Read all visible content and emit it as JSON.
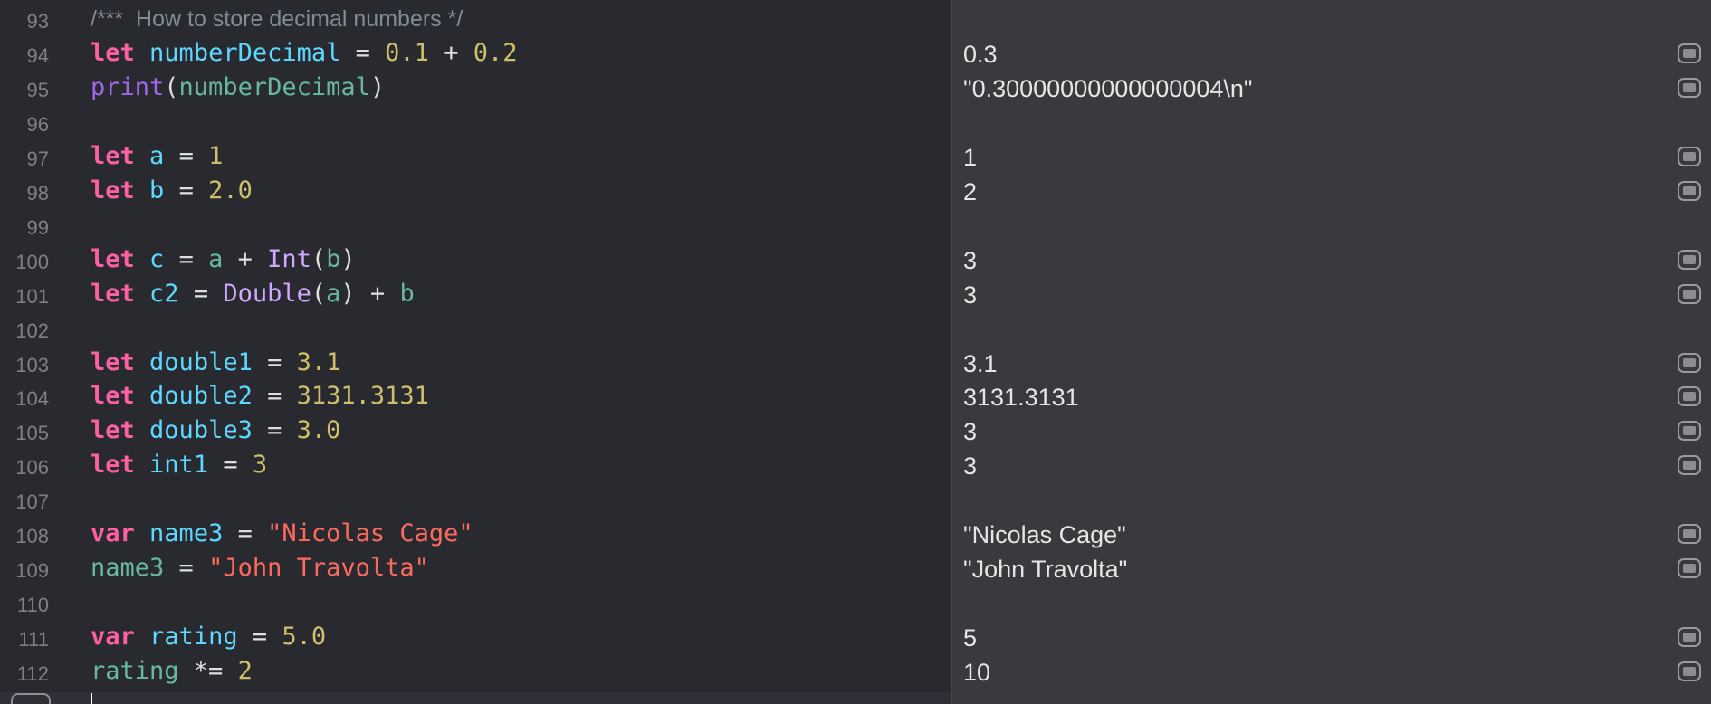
{
  "editor": {
    "lines": [
      {
        "num": "93",
        "comment": true,
        "tokens": [
          {
            "t": "/*** ",
            "c": "comment"
          },
          {
            "t": " How to store decimal numbers */",
            "c": "comment"
          }
        ]
      },
      {
        "num": "94",
        "tokens": [
          {
            "t": "let",
            "c": "kw"
          },
          {
            "t": " ",
            "c": "plain"
          },
          {
            "t": "numberDecimal",
            "c": "var"
          },
          {
            "t": " = ",
            "c": "plain"
          },
          {
            "t": "0.1",
            "c": "num"
          },
          {
            "t": " + ",
            "c": "plain"
          },
          {
            "t": "0.2",
            "c": "num"
          }
        ]
      },
      {
        "num": "95",
        "tokens": [
          {
            "t": "print",
            "c": "fn"
          },
          {
            "t": "(",
            "c": "plain"
          },
          {
            "t": "numberDecimal",
            "c": "ref"
          },
          {
            "t": ")",
            "c": "plain"
          }
        ]
      },
      {
        "num": "96",
        "tokens": []
      },
      {
        "num": "97",
        "tokens": [
          {
            "t": "let",
            "c": "kw"
          },
          {
            "t": " ",
            "c": "plain"
          },
          {
            "t": "a",
            "c": "var"
          },
          {
            "t": " = ",
            "c": "plain"
          },
          {
            "t": "1",
            "c": "num"
          }
        ]
      },
      {
        "num": "98",
        "tokens": [
          {
            "t": "let",
            "c": "kw"
          },
          {
            "t": " ",
            "c": "plain"
          },
          {
            "t": "b",
            "c": "var"
          },
          {
            "t": " = ",
            "c": "plain"
          },
          {
            "t": "2.0",
            "c": "num"
          }
        ]
      },
      {
        "num": "99",
        "tokens": []
      },
      {
        "num": "100",
        "tokens": [
          {
            "t": "let",
            "c": "kw"
          },
          {
            "t": " ",
            "c": "plain"
          },
          {
            "t": "c",
            "c": "var"
          },
          {
            "t": " = ",
            "c": "plain"
          },
          {
            "t": "a",
            "c": "ref"
          },
          {
            "t": " + ",
            "c": "plain"
          },
          {
            "t": "Int",
            "c": "type"
          },
          {
            "t": "(",
            "c": "plain"
          },
          {
            "t": "b",
            "c": "ref"
          },
          {
            "t": ")",
            "c": "plain"
          }
        ]
      },
      {
        "num": "101",
        "tokens": [
          {
            "t": "let",
            "c": "kw"
          },
          {
            "t": " ",
            "c": "plain"
          },
          {
            "t": "c2",
            "c": "var"
          },
          {
            "t": " = ",
            "c": "plain"
          },
          {
            "t": "Double",
            "c": "type"
          },
          {
            "t": "(",
            "c": "plain"
          },
          {
            "t": "a",
            "c": "ref"
          },
          {
            "t": ") + ",
            "c": "plain"
          },
          {
            "t": "b",
            "c": "ref"
          }
        ]
      },
      {
        "num": "102",
        "tokens": []
      },
      {
        "num": "103",
        "tokens": [
          {
            "t": "let",
            "c": "kw"
          },
          {
            "t": " ",
            "c": "plain"
          },
          {
            "t": "double1",
            "c": "var"
          },
          {
            "t": " = ",
            "c": "plain"
          },
          {
            "t": "3.1",
            "c": "num"
          }
        ]
      },
      {
        "num": "104",
        "tokens": [
          {
            "t": "let",
            "c": "kw"
          },
          {
            "t": " ",
            "c": "plain"
          },
          {
            "t": "double2",
            "c": "var"
          },
          {
            "t": " = ",
            "c": "plain"
          },
          {
            "t": "3131.3131",
            "c": "num"
          }
        ]
      },
      {
        "num": "105",
        "tokens": [
          {
            "t": "let",
            "c": "kw"
          },
          {
            "t": " ",
            "c": "plain"
          },
          {
            "t": "double3",
            "c": "var"
          },
          {
            "t": " = ",
            "c": "plain"
          },
          {
            "t": "3.0",
            "c": "num"
          }
        ]
      },
      {
        "num": "106",
        "tokens": [
          {
            "t": "let",
            "c": "kw"
          },
          {
            "t": " ",
            "c": "plain"
          },
          {
            "t": "int1",
            "c": "var"
          },
          {
            "t": " = ",
            "c": "plain"
          },
          {
            "t": "3",
            "c": "num"
          }
        ]
      },
      {
        "num": "107",
        "tokens": []
      },
      {
        "num": "108",
        "tokens": [
          {
            "t": "var",
            "c": "kw"
          },
          {
            "t": " ",
            "c": "plain"
          },
          {
            "t": "name3",
            "c": "var"
          },
          {
            "t": " = ",
            "c": "plain"
          },
          {
            "t": "\"Nicolas Cage\"",
            "c": "str"
          }
        ]
      },
      {
        "num": "109",
        "tokens": [
          {
            "t": "name3",
            "c": "ref"
          },
          {
            "t": " = ",
            "c": "plain"
          },
          {
            "t": "\"John Travolta\"",
            "c": "str"
          }
        ]
      },
      {
        "num": "110",
        "tokens": []
      },
      {
        "num": "111",
        "tokens": [
          {
            "t": "var",
            "c": "kw"
          },
          {
            "t": " ",
            "c": "plain"
          },
          {
            "t": "rating",
            "c": "var"
          },
          {
            "t": " = ",
            "c": "plain"
          },
          {
            "t": "5.0",
            "c": "num"
          }
        ]
      },
      {
        "num": "112",
        "tokens": [
          {
            "t": "rating",
            "c": "ref"
          },
          {
            "t": " *= ",
            "c": "plain"
          },
          {
            "t": "2",
            "c": "num"
          }
        ]
      }
    ]
  },
  "results": [
    {
      "value": ""
    },
    {
      "value": "0.3",
      "quicklook": true
    },
    {
      "value": "\"0.30000000000000004\\n\"",
      "quicklook": true
    },
    {
      "value": ""
    },
    {
      "value": "1",
      "quicklook": true
    },
    {
      "value": "2",
      "quicklook": true
    },
    {
      "value": ""
    },
    {
      "value": "3",
      "quicklook": true
    },
    {
      "value": "3",
      "quicklook": true
    },
    {
      "value": ""
    },
    {
      "value": "3.1",
      "quicklook": true
    },
    {
      "value": "3131.3131",
      "quicklook": true
    },
    {
      "value": "3",
      "quicklook": true
    },
    {
      "value": "3",
      "quicklook": true
    },
    {
      "value": ""
    },
    {
      "value": "\"Nicolas Cage\"",
      "quicklook": true
    },
    {
      "value": "\"John Travolta\"",
      "quicklook": true
    },
    {
      "value": ""
    },
    {
      "value": "5",
      "quicklook": true
    },
    {
      "value": "10",
      "quicklook": true
    }
  ],
  "colors": {
    "editor_bg": "#292a30",
    "results_bg": "#3a3a3e",
    "keyword": "#fc5fa3",
    "declaration": "#5dd8ff",
    "reference": "#67b7a4",
    "number": "#d0bf69",
    "string": "#fc6a5d",
    "type": "#d0a8ff",
    "function": "#a167e6",
    "comment": "#7f8c98"
  }
}
